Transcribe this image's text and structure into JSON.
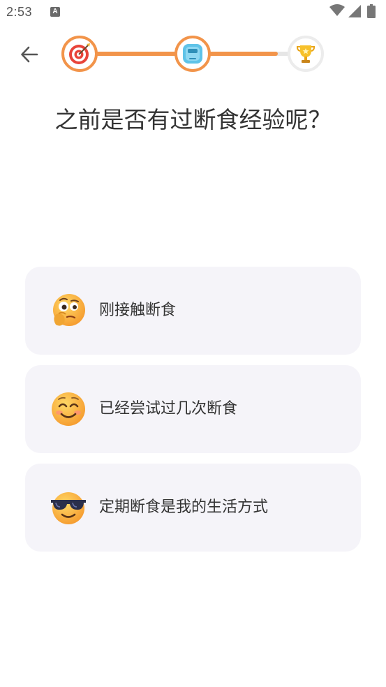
{
  "status_bar": {
    "time": "2:53",
    "app_icon_letter": "A",
    "icons": [
      "wifi-icon",
      "signal-icon",
      "battery-icon"
    ]
  },
  "header": {
    "back_icon": "arrow-left-icon",
    "progress": {
      "fraction": 0.875,
      "steps": [
        {
          "icon": "target-icon",
          "state": "completed"
        },
        {
          "icon": "scale-icon",
          "state": "current"
        },
        {
          "icon": "trophy-icon",
          "state": "upcoming"
        }
      ],
      "accent_color": "#f2944a",
      "track_color": "#e6e6e6"
    }
  },
  "question": {
    "title": "之前是否有过断食经验呢？"
  },
  "options": [
    {
      "emoji": "thinking-face-icon",
      "label": "刚接触断食"
    },
    {
      "emoji": "smiling-face-icon",
      "label": "已经尝试过几次断食"
    },
    {
      "emoji": "sunglasses-face-icon",
      "label": "定期断食是我的生活方式"
    }
  ],
  "colors": {
    "card_background": "#f5f4f9",
    "text": "#333333"
  }
}
